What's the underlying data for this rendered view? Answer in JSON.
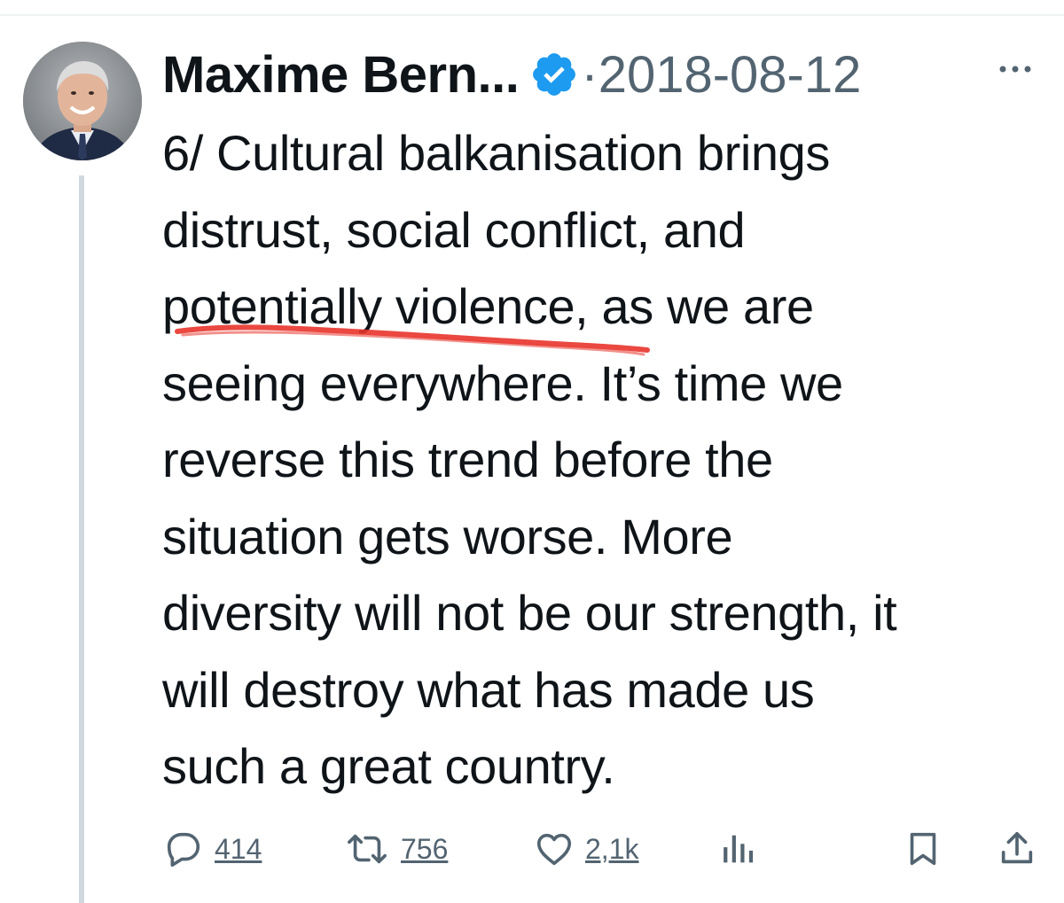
{
  "tweet": {
    "display_name": "Maxime Bern...",
    "separator": "·",
    "date": "2018-08-12",
    "text": "6/ Cultural balkanisation brings\ndistrust, social conflict, and\npotentially violence, as we are\nseeing everywhere. It’s time we\nreverse this trend before the\nsituation gets worse. More\ndiversity will not be our strength, it\nwill destroy what has made us\nsuch a great country.",
    "annotation_color": "#e8342b"
  },
  "actions": {
    "replies": "414",
    "retweets": "756",
    "likes": "2,1k"
  },
  "icons": [
    "avatar",
    "verified-badge-icon",
    "more-icon",
    "reply-icon",
    "retweet-icon",
    "like-icon",
    "views-icon",
    "bookmark-icon",
    "share-icon"
  ],
  "colors": {
    "verified": "#1d9bf0",
    "text": "#0f1419",
    "secondary": "#536471",
    "thread_line": "#cfd9de"
  }
}
